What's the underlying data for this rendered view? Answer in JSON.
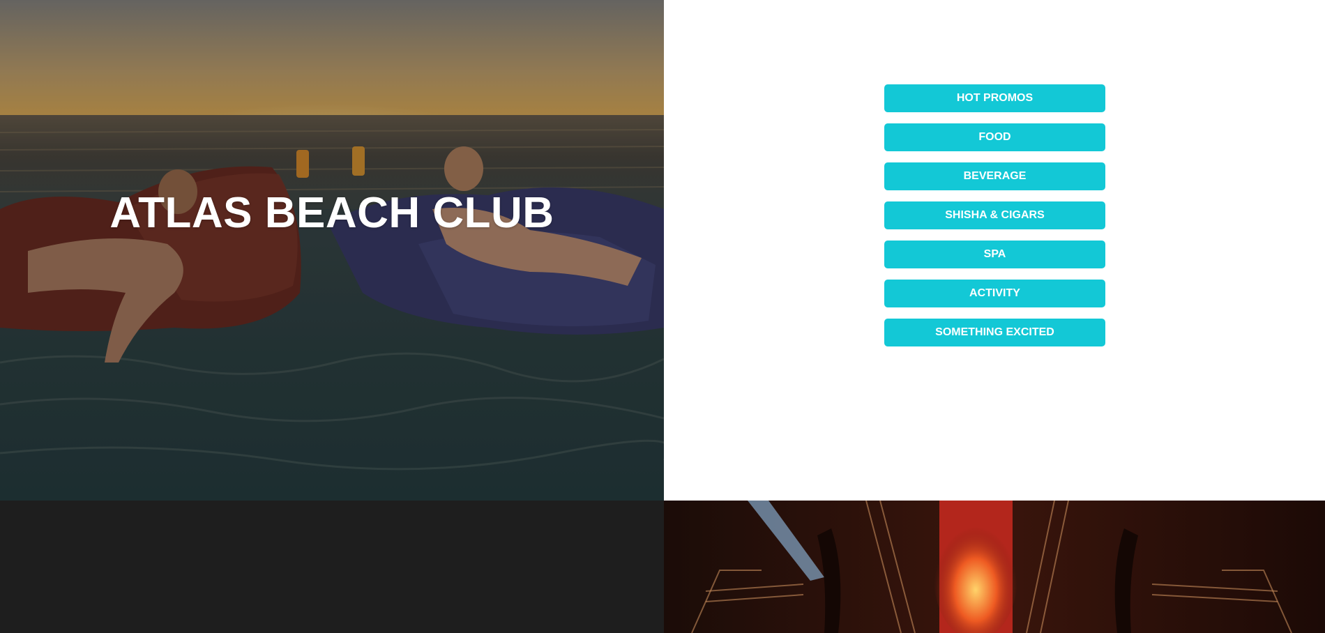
{
  "hero": {
    "title": "ATLAS BEACH CLUB",
    "image_alt": "beach-club-sunset-photo"
  },
  "menu": {
    "items": [
      {
        "label": "HOT PROMOS"
      },
      {
        "label": "FOOD"
      },
      {
        "label": "BEVERAGE"
      },
      {
        "label": "SHISHA & CIGARS"
      },
      {
        "label": "SPA"
      },
      {
        "label": "ACTIVITY"
      },
      {
        "label": "SOMETHING EXCITED"
      }
    ]
  },
  "colors": {
    "button_bg": "#13c8d6",
    "button_text": "#ffffff",
    "dark_band": "#1e1e1e"
  },
  "club": {
    "image_alt": "nightclub-stage-photo"
  }
}
